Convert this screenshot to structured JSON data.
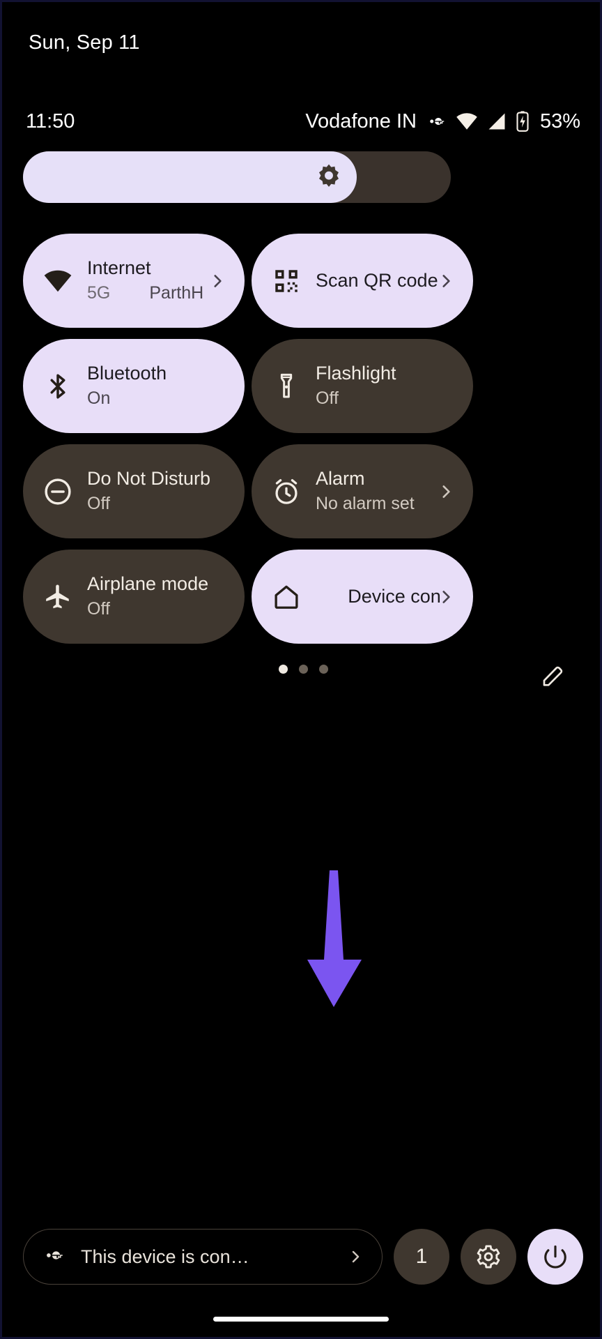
{
  "header": {
    "date": "Sun, Sep 11"
  },
  "status_bar": {
    "clock": "11:50",
    "carrier": "Vodafone IN",
    "battery_percent": "53%",
    "icons": [
      "vpn-key-icon",
      "wifi-icon",
      "cell-signal-icon",
      "battery-charging-icon"
    ]
  },
  "brightness": {
    "name": "brightness-slider",
    "level_percent": 78,
    "icon": "brightness-icon"
  },
  "tiles": [
    {
      "title": "Internet",
      "sub": "",
      "sub_left": "5G",
      "sub_right": "ParthH",
      "state": "on",
      "icon": "wifi-icon",
      "chevron": true,
      "centered": false
    },
    {
      "title": "Scan QR code",
      "sub": "",
      "state": "on",
      "icon": "qr-code-icon",
      "chevron": true,
      "centered": false
    },
    {
      "title": "Bluetooth",
      "sub": "On",
      "state": "on",
      "icon": "bluetooth-icon",
      "chevron": false,
      "centered": false
    },
    {
      "title": "Flashlight",
      "sub": "Off",
      "state": "off",
      "icon": "flashlight-icon",
      "chevron": false,
      "centered": false
    },
    {
      "title": "Do Not Disturb",
      "sub": "Off",
      "state": "off",
      "icon": "dnd-icon",
      "chevron": false,
      "centered": false
    },
    {
      "title": "Alarm",
      "sub": "No alarm set",
      "state": "off",
      "icon": "alarm-icon",
      "chevron": true,
      "centered": false
    },
    {
      "title": "Airplane mode",
      "sub": "Off",
      "state": "off",
      "icon": "airplane-icon",
      "chevron": false,
      "centered": false
    },
    {
      "title": "Device con",
      "sub": "",
      "state": "on",
      "icon": "home-icon",
      "chevron": true,
      "centered": true
    }
  ],
  "pager": {
    "pages": 3,
    "current": 1,
    "edit_icon": "pencil-icon"
  },
  "annotation": {
    "type": "arrow",
    "color": "#7B55F0",
    "points_to": "notification-count-button"
  },
  "footer": {
    "vpn_chip": {
      "label": "This device is con…",
      "icon": "vpn-key-icon",
      "chevron": "chevron-right-icon"
    },
    "notification_count": "1",
    "settings_icon": "gear-icon",
    "power_icon": "power-icon"
  },
  "colors": {
    "background": "#000000",
    "tile_on": "#E8DEF8",
    "tile_off": "#3F372F",
    "accent_arrow": "#7B55F0",
    "text_on_light": "#1d1b20",
    "text_on_dark": "#f2ece4"
  }
}
